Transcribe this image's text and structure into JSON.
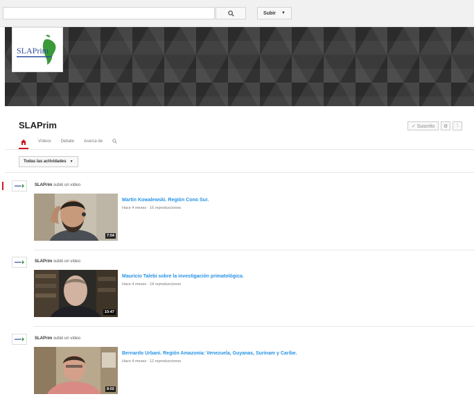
{
  "header": {
    "search_placeholder": "",
    "upload_label": "Subir"
  },
  "channel": {
    "logo_text": "SLAPrim",
    "name": "SLAPrim",
    "subscribe_label": "✓ Suscrito",
    "tabs": [
      "Vídeos",
      "Debate",
      "Acerca de"
    ]
  },
  "filter": {
    "label": "Todas las actividades"
  },
  "colors": {
    "accent": "#cc181e",
    "link": "#2793e6"
  },
  "feed": [
    {
      "actor": "SLAPrim",
      "action": "subió un vídeo",
      "title": "Martín Kowalewski. Región Cono Sur.",
      "meta": "Hace 4 meses · 16 reproducciones",
      "duration": "7:04"
    },
    {
      "actor": "SLAPrim",
      "action": "subió un vídeo",
      "title": "Mauricio Talebi sobre la investigación primatológica.",
      "meta": "Hace 4 meses · 18 reproducciones",
      "duration": "10:47"
    },
    {
      "actor": "SLAPrim",
      "action": "subió un vídeo",
      "title": "Bernardo Urbani. Región Amazonia: Venezuela, Guyanas, Surinam y Caribe.",
      "meta": "Hace 4 meses · 12 reproducciones",
      "duration": "8:02"
    }
  ]
}
